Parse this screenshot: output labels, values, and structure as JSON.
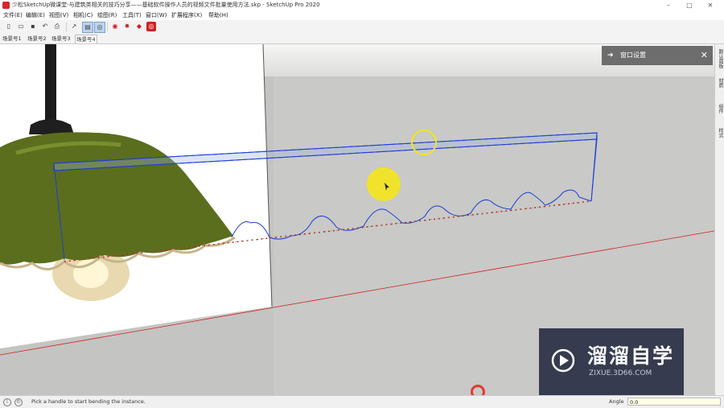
{
  "window": {
    "title": "少松SketchUp微课堂-与建筑类相关的技巧分享——基础软件操作人员的视频文件批量使用方法.skp - SketchUp Pro 2020",
    "minimize": "–",
    "maximize": "□",
    "close": "✕"
  },
  "menu": [
    "文件(E)",
    "编辑(E)",
    "视图(V)",
    "相机(C)",
    "绘图(R)",
    "工具(T)",
    "窗口(W)",
    "扩展程序(X)",
    "帮助(H)"
  ],
  "scene_tabs": [
    "场景号1",
    "场景号2",
    "场景号3",
    "场景号4"
  ],
  "active_scene_tab": "场景号4",
  "tray": {
    "title": "窗口设置",
    "arrow": "➔",
    "close": "✕"
  },
  "right_tabs": [
    "默认面板",
    "材质",
    "组件",
    "样式"
  ],
  "status": {
    "hint": "Pick a handle to start bending the instance.",
    "measure_label": "Angle",
    "measure_value": "0.0"
  },
  "watermark": {
    "title": "溜溜自学",
    "url": "ZIXUE.3D66.COM"
  },
  "colors": {
    "selection_blue": "#1b3fd4",
    "edge_red": "#d01f1f",
    "cursor_yellow": "#f5e51a",
    "lamp_green": "#5b6e1d"
  }
}
